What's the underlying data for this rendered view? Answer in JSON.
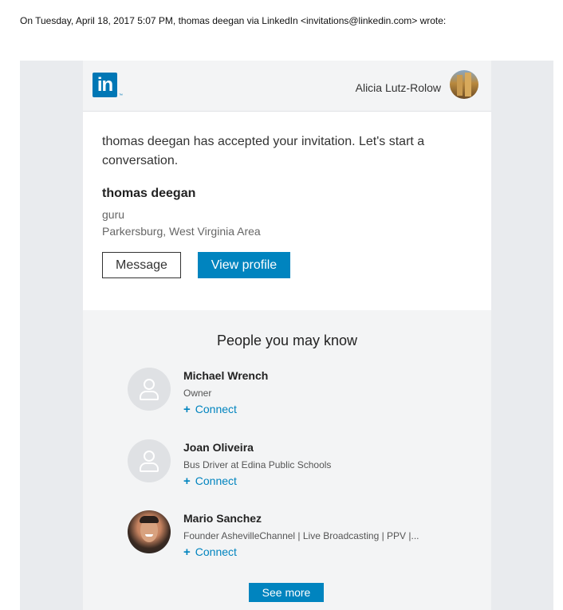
{
  "quote_header": "On Tuesday, April 18, 2017 5:07 PM, thomas deegan via LinkedIn <invitations@linkedin.com> wrote:",
  "header": {
    "logo_text": "in",
    "logo_tm": "™",
    "user_name": "Alicia Lutz-Rolow"
  },
  "invitation": {
    "message": "thomas deegan has accepted your invitation. Let's start a conversation.",
    "name": "thomas deegan",
    "headline": "guru",
    "location": "Parkersburg, West Virginia Area",
    "message_button": "Message",
    "view_profile_button": "View profile"
  },
  "pymk": {
    "title": "People you may know",
    "connect_label": "Connect",
    "connect_icon": "+",
    "see_more": "See more",
    "people": [
      {
        "name": "Michael Wrench",
        "headline": "Owner",
        "avatar": "placeholder-avatar-icon"
      },
      {
        "name": "Joan Oliveira",
        "headline": "Bus Driver at Edina Public Schools",
        "avatar": "placeholder-avatar-icon"
      },
      {
        "name": "Mario Sanchez",
        "headline": "Founder AshevilleChannel | Live Broadcasting | PPV |...",
        "avatar": "photo"
      }
    ]
  },
  "colors": {
    "brand_blue": "#0077b5",
    "button_blue": "#0084bf",
    "outer_bg": "#e9ebee",
    "panel_bg": "#f3f4f5"
  }
}
